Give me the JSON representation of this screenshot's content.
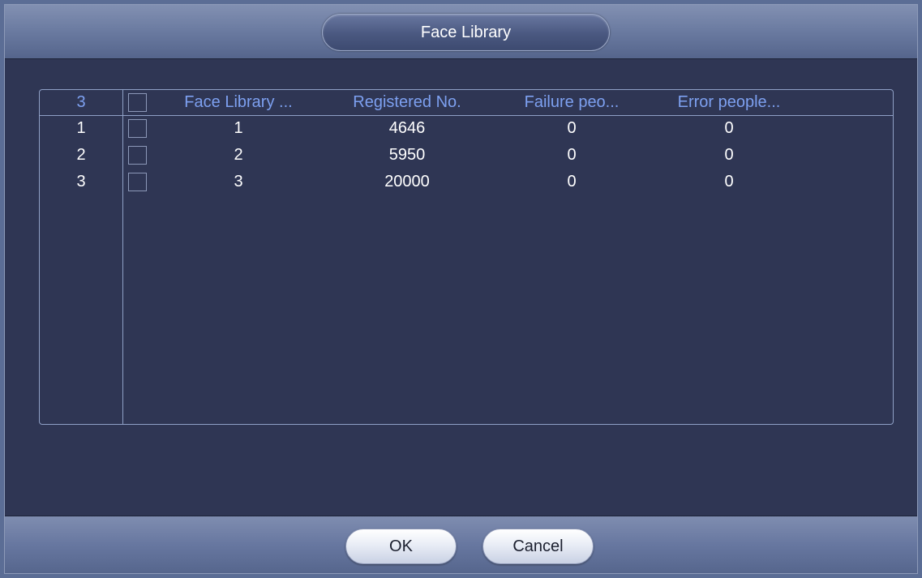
{
  "window": {
    "title": "Face Library"
  },
  "table": {
    "header": {
      "count": "3",
      "name": "Face Library ...",
      "registered": "Registered No.",
      "failure": "Failure peo...",
      "error": "Error people..."
    },
    "rows": [
      {
        "index": "1",
        "name": "1",
        "registered": "4646",
        "failure": "0",
        "error": "0"
      },
      {
        "index": "2",
        "name": "2",
        "registered": "5950",
        "failure": "0",
        "error": "0"
      },
      {
        "index": "3",
        "name": "3",
        "registered": "20000",
        "failure": "0",
        "error": "0"
      }
    ]
  },
  "buttons": {
    "ok": "OK",
    "cancel": "Cancel"
  },
  "colors": {
    "window_bg": "#2f3654",
    "header_text": "#7da0f0",
    "row_text": "#ffffff"
  }
}
